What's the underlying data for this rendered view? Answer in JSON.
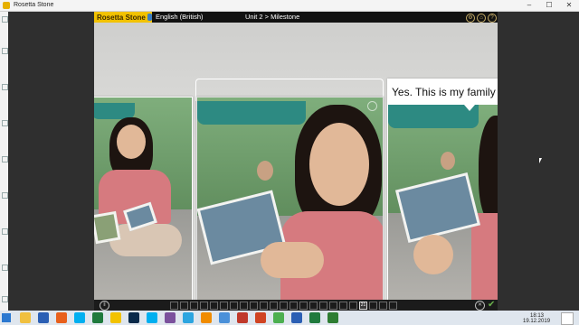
{
  "window": {
    "title": "Rosetta Stone",
    "controls": {
      "minimize": "–",
      "maximize": "☐",
      "close": "✕"
    }
  },
  "app": {
    "logo_text": "Rosetta Stone",
    "language": "English (British)",
    "breadcrumb": "Unit 2 > Milestone",
    "header_icons": [
      "settings-icon",
      "home-icon",
      "help-icon"
    ]
  },
  "cards": [
    {
      "id": "left",
      "caption": ""
    },
    {
      "id": "center",
      "caption": ""
    },
    {
      "id": "right",
      "caption": "Yes. This is my family"
    }
  ],
  "footer": {
    "current_page": "21",
    "pages_before": 19,
    "pages_after": 3,
    "icons": [
      "pause-icon",
      "close-icon",
      "check-icon"
    ]
  },
  "taskbar": {
    "apps": [
      "file-explorer-icon",
      "word-icon",
      "firefox-icon",
      "skype-icon",
      "excel-icon",
      "rosetta-icon",
      "photoshop-icon",
      "skype-icon",
      "viber-icon",
      "telegram-icon",
      "vlc-icon",
      "network-icon",
      "acrobat-icon",
      "powerpoint-icon",
      "chrome-icon",
      "word-icon",
      "notes-icon",
      "rosetta-icon"
    ],
    "time": "18:13",
    "date": "19.12.2019"
  },
  "colors": {
    "logo_yellow": "#f2c200",
    "header_black": "#111111",
    "canopy_teal": "#2d8a82",
    "shirt_pink": "#d67a7f",
    "accent_green": "#6ab04c"
  }
}
